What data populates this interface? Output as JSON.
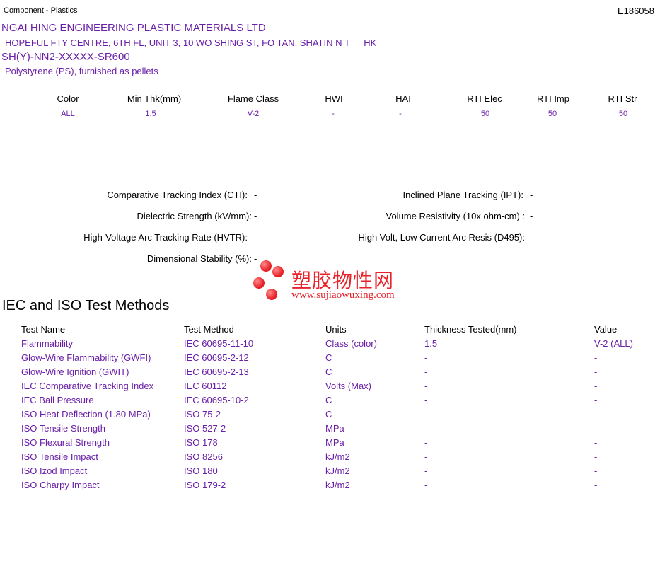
{
  "header": {
    "component": "Component - Plastics",
    "file_number": "E186058"
  },
  "company": {
    "name": "NGAI HING ENGINEERING PLASTIC MATERIALS LTD",
    "address": "HOPEFUL FTY CENTRE, 6TH FL, UNIT 3, 10 WO SHING ST, FO TAN, SHATIN N T",
    "country": "HK"
  },
  "product": {
    "grade": "SH(Y)-NN2-XXXXX-SR600",
    "description": "Polystyrene (PS), furnished as pellets"
  },
  "ratings": {
    "headers": [
      "Color",
      "Min Thk(mm)",
      "Flame Class",
      "HWI",
      "HAI",
      "RTI Elec",
      "RTI Imp",
      "RTI Str"
    ],
    "values": [
      "ALL",
      "1.5",
      "V-2",
      "-",
      "-",
      "50",
      "50",
      "50"
    ]
  },
  "properties": {
    "cti_label": "Comparative Tracking Index (CTI):",
    "cti_value": "-",
    "ipt_label": "Inclined Plane Tracking (IPT):",
    "ipt_value": "-",
    "ds_label": "Dielectric Strength (kV/mm):",
    "ds_value": "-",
    "vr_label": "Volume Resistivity (10x ohm-cm) :",
    "vr_value": "-",
    "hvtr_label": "High-Voltage Arc Tracking Rate (HVTR):",
    "hvtr_value": "-",
    "d495_label": "High Volt, Low Current Arc Resis (D495):",
    "d495_value": "-",
    "dim_label": "Dimensional Stability (%):",
    "dim_value": "-"
  },
  "watermark": {
    "chinese": "塑胶物性网",
    "url": "www.sujiaowuxing.com",
    "color": "#e8222a"
  },
  "tests": {
    "section_title": "IEC and ISO Test Methods",
    "headers": [
      "Test Name",
      "Test Method",
      "Units",
      "Thickness Tested(mm)",
      "Value"
    ],
    "rows": [
      [
        "Flammability",
        "IEC 60695-11-10",
        "Class (color)",
        "1.5",
        "V-2 (ALL)"
      ],
      [
        "Glow-Wire Flammability (GWFI)",
        "IEC 60695-2-12",
        "C",
        "-",
        "-"
      ],
      [
        "Glow-Wire Ignition (GWIT)",
        "IEC 60695-2-13",
        "C",
        "-",
        "-"
      ],
      [
        "IEC Comparative Tracking Index",
        "IEC 60112",
        "Volts (Max)",
        "-",
        "-"
      ],
      [
        "IEC Ball Pressure",
        "IEC 60695-10-2",
        "C",
        "-",
        "-"
      ],
      [
        "ISO Heat Deflection (1.80 MPa)",
        "ISO 75-2",
        "C",
        "-",
        "-"
      ],
      [
        "ISO Tensile Strength",
        "ISO 527-2",
        "MPa",
        "-",
        "-"
      ],
      [
        "ISO Flexural Strength",
        "ISO 178",
        "MPa",
        "-",
        "-"
      ],
      [
        "ISO Tensile Impact",
        "ISO 8256",
        "kJ/m2",
        "-",
        "-"
      ],
      [
        "ISO Izod Impact",
        "ISO 180",
        "kJ/m2",
        "-",
        "-"
      ],
      [
        "ISO Charpy Impact",
        "ISO 179-2",
        "kJ/m2",
        "-",
        "-"
      ]
    ]
  },
  "colors": {
    "accent": "#6a1fa8"
  }
}
